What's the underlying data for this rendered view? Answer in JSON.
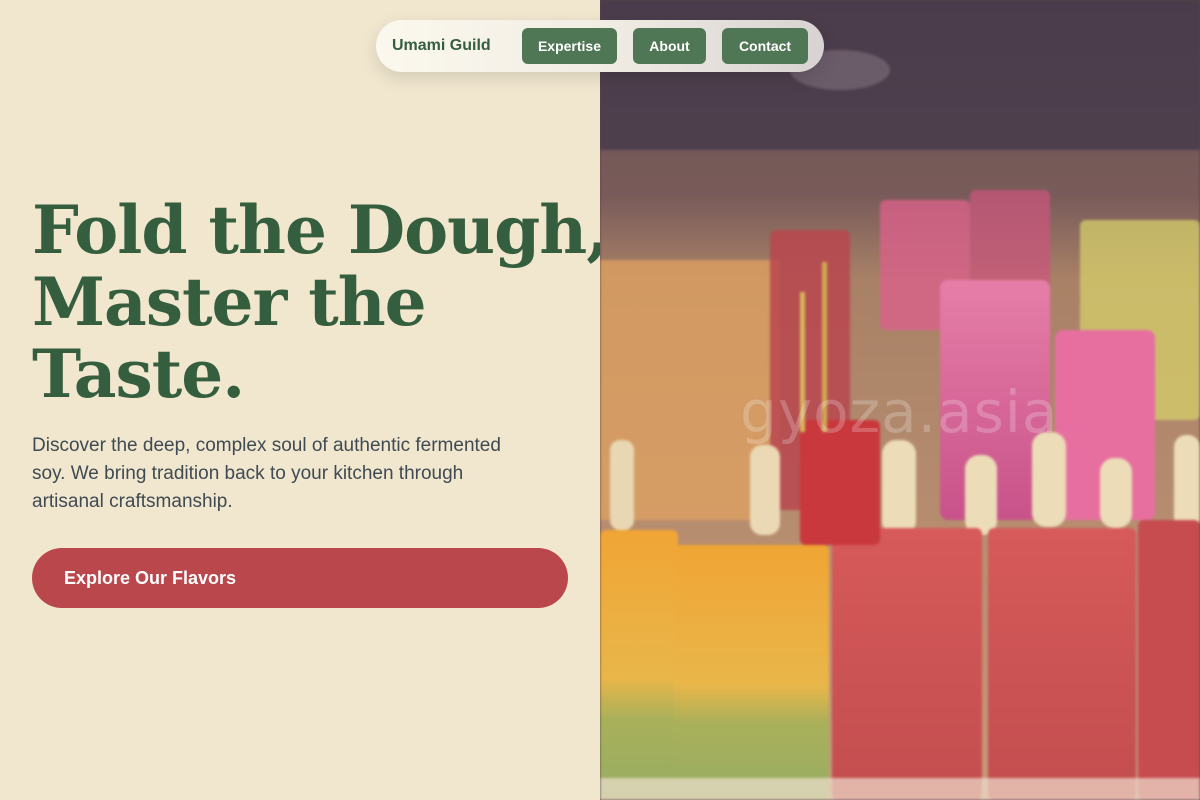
{
  "nav": {
    "brand": "Umami Guild",
    "links": [
      "Expertise",
      "About",
      "Contact"
    ]
  },
  "hero": {
    "headline_lines": [
      "Fold the Dough,",
      "Master the",
      "Taste."
    ],
    "description": "Discover the deep, complex soul of authentic fermented soy. We bring tradition back to your kitchen through artisanal craftsmanship.",
    "cta": "Explore Our Flavors"
  },
  "image": {
    "watermark": "gyoza.asia",
    "subject": "popsicles"
  },
  "colors": {
    "background": "#f1e7cf",
    "brand_green": "#355e3f",
    "button_green": "#4f7655",
    "cta_red": "#b9474c",
    "body_text": "#3f4a52"
  }
}
